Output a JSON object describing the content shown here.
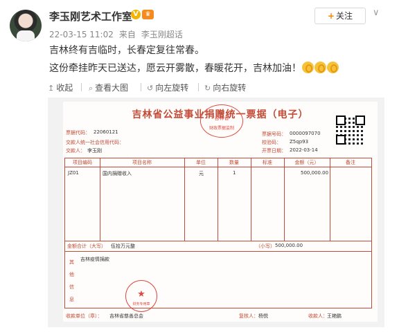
{
  "post": {
    "author": "李玉刚艺术工作室",
    "verified_badge": "V",
    "member_badge": "♛",
    "follow_label": "关注",
    "more_label": "∨",
    "time": "22-03-15 11:02",
    "source_prefix": "来自",
    "source": "李玉刚超话",
    "line1": "吉林终有吉临时，长春定复往常春。",
    "line2": "这份牵挂昨天已送达，愿云开雾散，春暖花开，吉林加油！",
    "emoji_count": 3,
    "emoji_name": "strong-arm-emoji"
  },
  "actions": [
    {
      "label": "收起",
      "icon": "up-arrow-icon"
    },
    {
      "label": "查看大图",
      "icon": "magnifier-icon"
    },
    {
      "label": "向左旋转",
      "icon": "rotate-left-icon"
    },
    {
      "label": "向右旋转",
      "icon": "rotate-right-icon"
    }
  ],
  "receipt": {
    "title": "吉林省公益事业捐赠统一票据（电子）",
    "seal_top_text": "吉林省",
    "seal_top_sub": "财政票据监制",
    "code_label": "票据代码：",
    "code_value": "22060121",
    "payer_id_label": "交款人统一社会信用代码：",
    "payer_label": "交款人：",
    "payer_value": "李玉刚",
    "number_label": "票据号码：",
    "number_value": "0000097070",
    "check_label": "校验码：",
    "check_value": "Z5qp93",
    "date_label": "开票日期：",
    "date_value": "2022-03-14",
    "columns": [
      "项目编码",
      "项目名称",
      "单位",
      "数量",
      "标准",
      "金额（元）",
      "备注"
    ],
    "row": {
      "code": "JZ01",
      "name": "国内捐赠收入",
      "unit": "元",
      "qty": "1",
      "std": "",
      "amount": "500,000.00",
      "note": ""
    },
    "total_label": "金额合计（大写）",
    "total_upper": "伍拾万元整",
    "small_label": "（小写）",
    "small_value": "500,000.00",
    "notes_label": "其他信息",
    "notes_value": "吉林疫情捐款",
    "seal_bottom_text": "吉林省慈善总会",
    "seal_bottom_sub": "财务专用章",
    "collector_label": "收款单位（章）：",
    "collector_value": "吉林省慈善总会",
    "reviewer_label": "复核人：",
    "reviewer_value": "杨悦",
    "payee_label": "收款人：",
    "payee_value": "王艳鹏"
  },
  "colors": {
    "accent": "#ff8200",
    "receipt_red": "#c24a36",
    "seal_red": "#e04a40"
  }
}
